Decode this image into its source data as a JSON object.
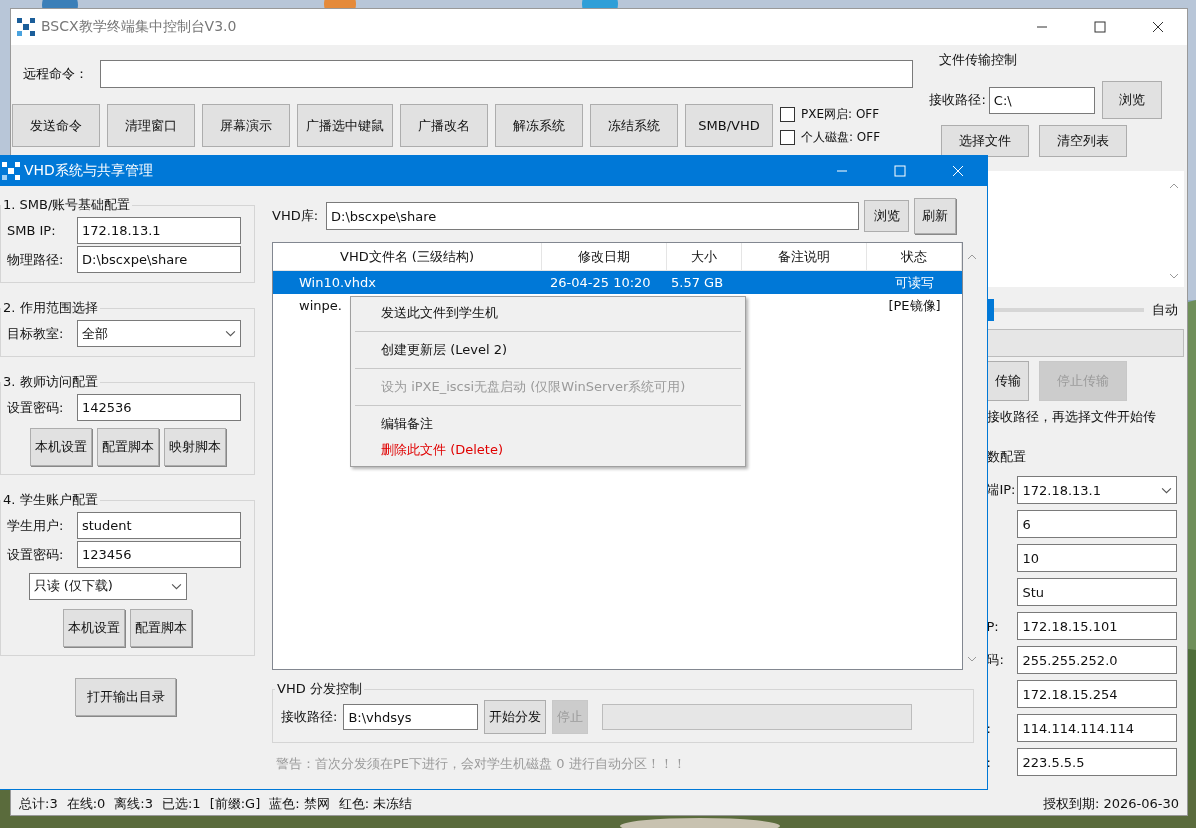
{
  "main_window": {
    "title": "BSCX教学终端集中控制台V3.0",
    "remote_command": {
      "label": "远程命令："
    },
    "toolbar_buttons": [
      "发送命令",
      "清理窗口",
      "屏幕演示",
      "广播选中键鼠",
      "广播改名",
      "解冻系统",
      "冻结系统",
      "SMB/VHD"
    ],
    "toggles": [
      {
        "label": "PXE网启: OFF",
        "checked": false
      },
      {
        "label": "个人磁盘: OFF",
        "checked": false
      }
    ],
    "file_transfer": {
      "title": "文件传输控制",
      "path_label": "接收路径:",
      "path_value": "C:\\",
      "browse": "浏览",
      "select_files": "选择文件",
      "clear_list": "清空列表",
      "slider": {
        "level": 0.2
      },
      "slider_label": "自动",
      "progress": {
        "level": 0
      },
      "buttons": [
        {
          "label": "传输",
          "disabled": false
        },
        {
          "label": "停止传输",
          "disabled": true
        }
      ],
      "hint": "接收路径，再选择文件开始传"
    },
    "params": {
      "title": "数配置",
      "rows": [
        {
          "kind": "combo",
          "label": "端IP:",
          "value": "172.18.13.1"
        },
        {
          "kind": "field",
          "value": "6"
        },
        {
          "kind": "field",
          "value": "10"
        },
        {
          "kind": "field",
          "value": "Stu"
        },
        {
          "kind": "field",
          "label": "P:",
          "value": "172.18.15.101"
        },
        {
          "kind": "field",
          "label": "码:",
          "value": "255.255.252.0"
        },
        {
          "kind": "field",
          "value": "172.18.15.254"
        },
        {
          "kind": "field",
          "label": ":",
          "value": "114.114.114.114"
        },
        {
          "kind": "field",
          "label": ":",
          "value": "223.5.5.5"
        }
      ]
    },
    "status_bar": {
      "items": [
        "总计:3",
        "在线:0",
        "离线:3",
        "已选:1",
        "[前缀:G]",
        "蓝色: 禁网",
        "红色: 未冻结"
      ],
      "license": "授权到期: 2026-06-30"
    }
  },
  "dialog": {
    "title": "VHD系统与共享管理",
    "groups": [
      {
        "title": "1. SMB/账号基础配置",
        "items": [
          {
            "kind": "field",
            "label": "SMB IP:",
            "value": "172.18.13.1"
          },
          {
            "kind": "field",
            "label": "物理路径:",
            "value": "D:\\bscxpe\\share"
          }
        ]
      },
      {
        "title": "2. 作用范围选择",
        "items": [
          {
            "kind": "combo",
            "label": "目标教室:",
            "value": "全部"
          }
        ]
      },
      {
        "title": "3. 教师访问配置",
        "items": [
          {
            "kind": "field",
            "label": "设置密码:",
            "value": "142536"
          },
          {
            "kind": "buttons",
            "buttons": [
              "本机设置",
              "配置脚本",
              "映射脚本"
            ]
          }
        ]
      },
      {
        "title": "4. 学生账户配置",
        "items": [
          {
            "kind": "field",
            "label": "学生用户:",
            "value": "student"
          },
          {
            "kind": "field",
            "label": "设置密码:",
            "value": "123456"
          },
          {
            "kind": "combo",
            "value": "只读 (仅下载)"
          },
          {
            "kind": "buttons",
            "buttons": [
              "本机设置",
              "配置脚本"
            ]
          }
        ]
      }
    ],
    "output_button": "打开输出目录",
    "library": {
      "label": "VHD库:",
      "value": "D:\\bscxpe\\share",
      "browse": "浏览",
      "refresh": "刷新"
    },
    "table": {
      "columns": [
        "VHD文件名 (三级结构)",
        "修改日期",
        "大小",
        "备注说明",
        "状态"
      ],
      "rows": [
        {
          "name": "Win10.vhdx",
          "modified": "26-04-25 10:20",
          "size": "5.57 GB",
          "status": "可读写",
          "selected": true
        },
        {
          "name": "winpe.",
          "status": "[PE镜像]",
          "selected": false
        }
      ]
    },
    "context_menu": [
      {
        "kind": "item",
        "label": "发送此文件到学生机",
        "disabled": false
      },
      {
        "kind": "separator"
      },
      {
        "kind": "item",
        "label": "创建更新层 (Level 2)",
        "disabled": false
      },
      {
        "kind": "separator"
      },
      {
        "kind": "item",
        "label": "设为 iPXE_iscsi无盘启动 (仅限WinServer系统可用)",
        "disabled": true
      },
      {
        "kind": "separator"
      },
      {
        "kind": "item",
        "label": "编辑备注",
        "disabled": false
      },
      {
        "kind": "danger",
        "label": "删除此文件 (Delete)",
        "disabled": false
      }
    ],
    "distribution": {
      "title": "VHD 分发控制",
      "path_label": "接收路径:",
      "path_value": "B:\\vhdsys",
      "start": {
        "label": "开始分发",
        "disabled": false
      },
      "stop": {
        "label": "停止",
        "disabled": true
      },
      "progress": {
        "level": 0
      }
    },
    "warning": "警告：首次分发须在PE下进行，会对学生机磁盘 0 进行自动分区！！！"
  }
}
